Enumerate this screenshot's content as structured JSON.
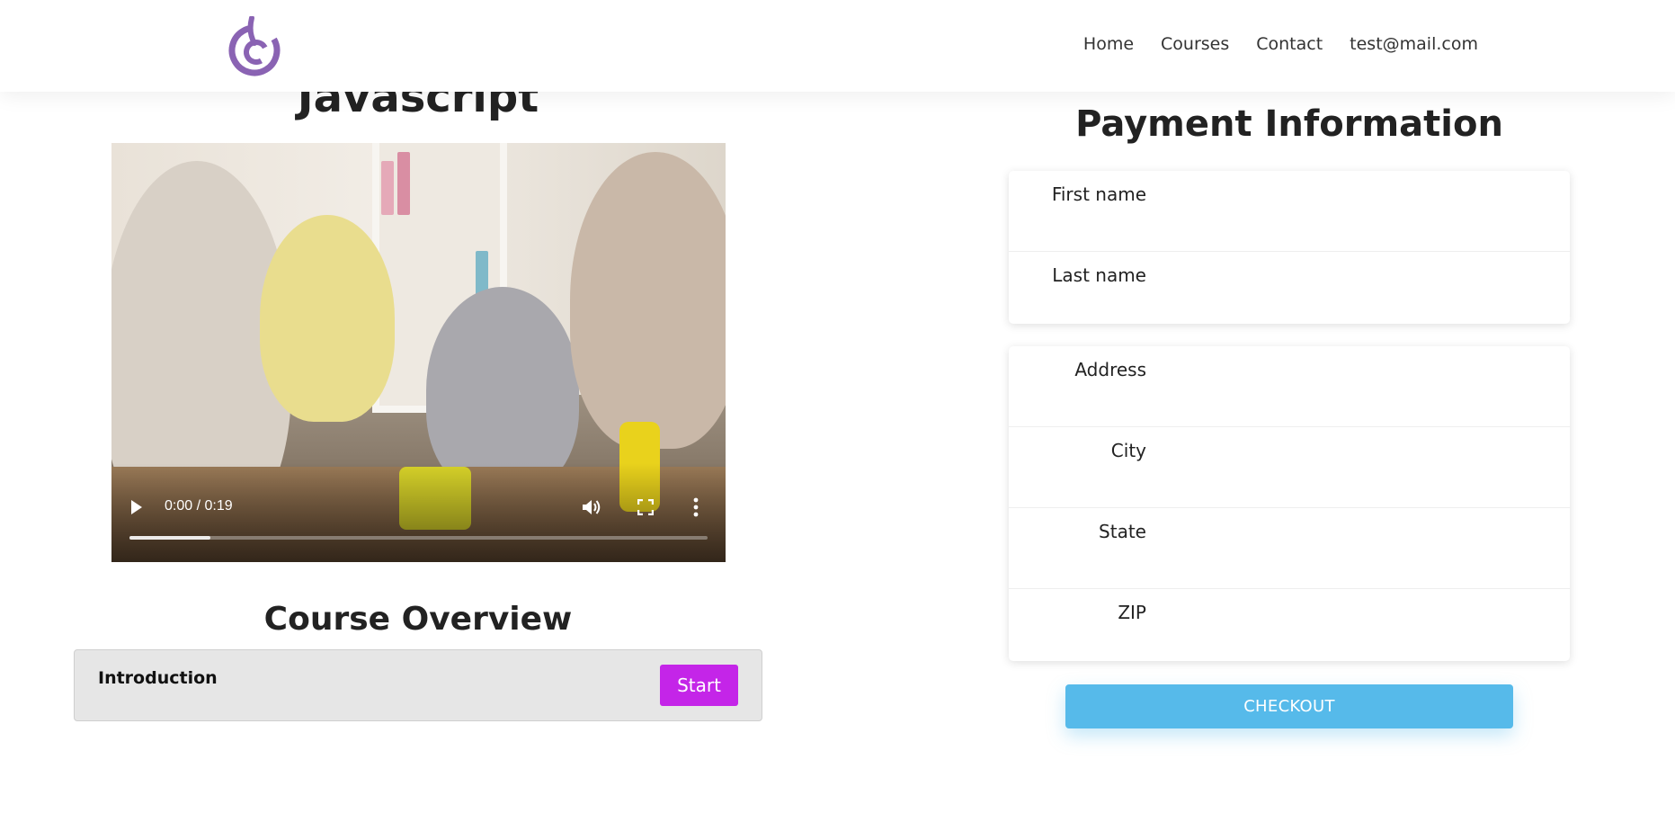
{
  "header": {
    "nav": [
      {
        "label": "Home"
      },
      {
        "label": "Courses"
      },
      {
        "label": "Contact"
      },
      {
        "label": "test@mail.com"
      }
    ]
  },
  "course": {
    "title": "Javascript",
    "video": {
      "time": "0:00 / 0:19",
      "buffered_fraction": 0.14
    },
    "overview_title": "Course Overview",
    "lessons": [
      {
        "name": "Introduction",
        "action_label": "Start"
      }
    ]
  },
  "payment": {
    "title": "Payment Information",
    "name_fields": [
      {
        "label": "First name",
        "value": ""
      },
      {
        "label": "Last name",
        "value": ""
      }
    ],
    "address_fields": [
      {
        "label": "Address",
        "value": ""
      },
      {
        "label": "City",
        "value": ""
      },
      {
        "label": "State",
        "value": ""
      },
      {
        "label": "ZIP",
        "value": ""
      }
    ],
    "checkout_label": "CHECKOUT"
  },
  "colors": {
    "logo": "#8a63b3",
    "start_button": "#c425e8",
    "checkout_button": "#56baea"
  }
}
